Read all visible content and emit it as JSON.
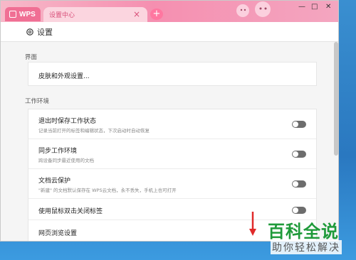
{
  "app": {
    "brand": "WPS",
    "tab_label": "设置中心",
    "tab_close": "×",
    "new_tab": "+"
  },
  "window_controls": {
    "minimize": "—",
    "maximize": "□",
    "close": "✕"
  },
  "header": {
    "title": "设置"
  },
  "sections": [
    {
      "label": "界面"
    },
    {
      "label": "工作环境"
    }
  ],
  "appearance": {
    "label": "皮肤和外观设置..."
  },
  "settings": [
    {
      "title": "退出时保存工作状态",
      "desc": "记录当前打开的标签和编辑状态，下次启动时自动恢复",
      "enabled": false
    },
    {
      "title": "同步工作环境",
      "desc": "跨设备同步最近使用的文档",
      "enabled": false
    },
    {
      "title": "文档云保护",
      "desc": "\"新建\" 的文档默认保存在 WPS云文档，永不丢失，手机上也可打开",
      "enabled": false
    },
    {
      "title": "使用鼠标双击关闭标签",
      "desc": "",
      "enabled": false
    },
    {
      "title": "网页浏览设置",
      "desc": "",
      "enabled": false
    }
  ],
  "watermark": {
    "big": "百科全说",
    "small": "助你轻松解决"
  },
  "colors": {
    "titlebar": "#f58fb0",
    "accent": "#d9507a",
    "toggle": "#6d6d6d",
    "watermark_green": "#1f9a3a"
  }
}
